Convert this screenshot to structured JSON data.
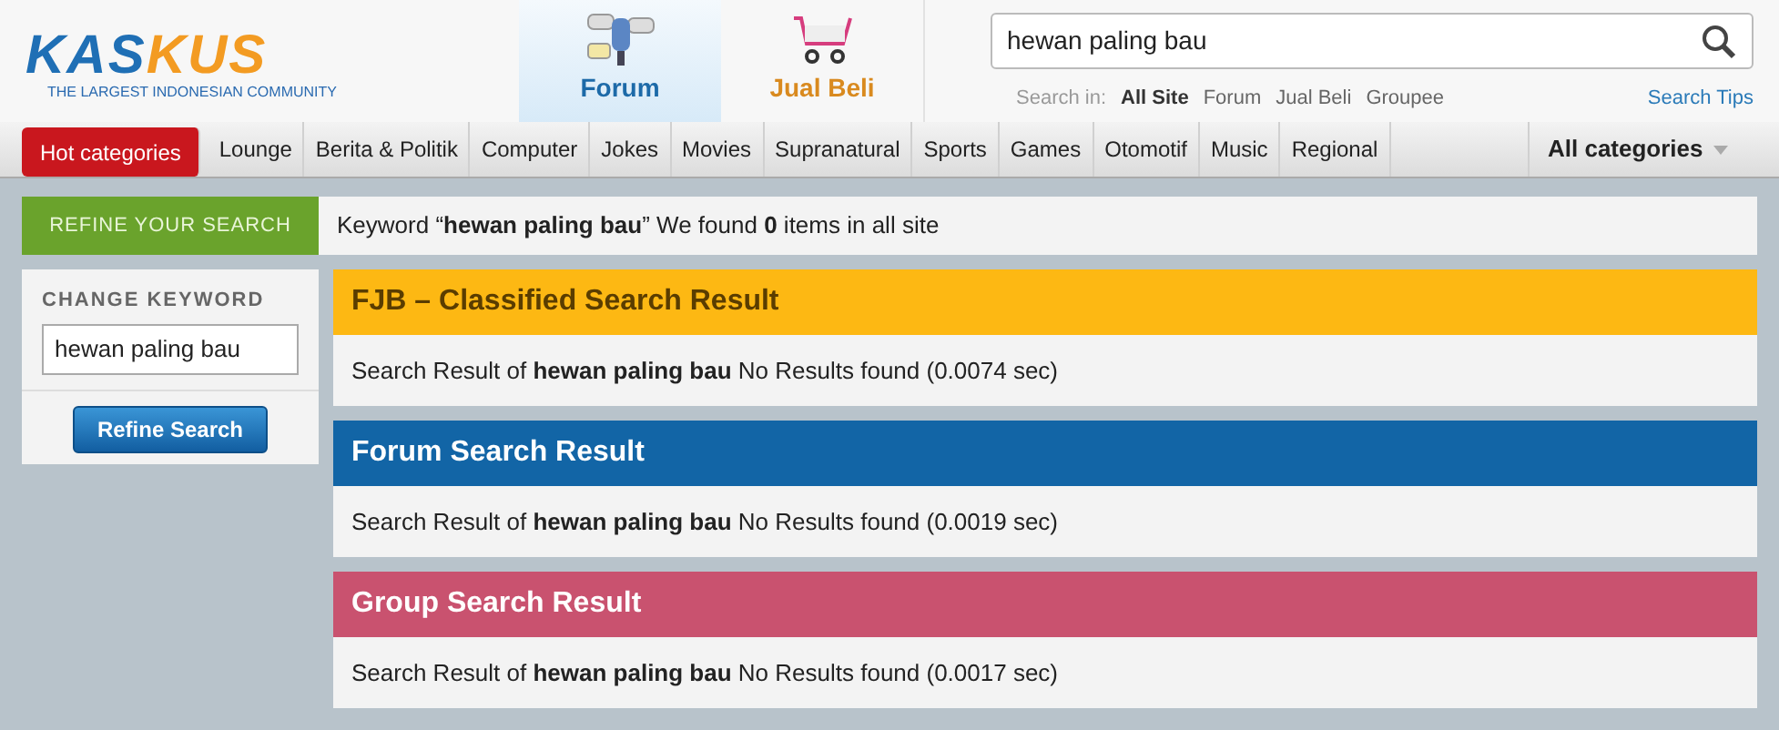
{
  "logo": {
    "part_one": "KAS",
    "part_two": "KUS",
    "tagline": "THE LARGEST INDONESIAN COMMUNITY"
  },
  "channel_tabs": [
    {
      "label": "Forum",
      "kind": "forum",
      "selected": true
    },
    {
      "label": "Jual Beli",
      "kind": "shop",
      "selected": false
    }
  ],
  "search": {
    "value": "hewan paling bau",
    "search_in_label": "Search in:",
    "scopes": [
      {
        "label": "All Site",
        "selected": true
      },
      {
        "label": "Forum",
        "selected": false
      },
      {
        "label": "Jual Beli",
        "selected": false
      },
      {
        "label": "Groupee",
        "selected": false
      }
    ],
    "tips": "Search Tips"
  },
  "categories": [
    {
      "label": "Hot categories",
      "selected": true
    },
    {
      "label": "Lounge",
      "selected": false
    },
    {
      "label": "Berita & Politik",
      "selected": false
    },
    {
      "label": "Computer",
      "selected": false
    },
    {
      "label": "Jokes",
      "selected": false
    },
    {
      "label": "Movies",
      "selected": false
    },
    {
      "label": "Supranatural",
      "selected": false
    },
    {
      "label": "Sports",
      "selected": false
    },
    {
      "label": "Games",
      "selected": false
    },
    {
      "label": "Otomotif",
      "selected": false
    },
    {
      "label": "Music",
      "selected": false
    },
    {
      "label": "Regional",
      "selected": false
    }
  ],
  "all_categories": "All categories",
  "refine": {
    "title": "REFINE YOUR SEARCH",
    "summary": "Keyword “**hewan paling bau**” We found **0** items in all site",
    "change_label": "CHANGE KEYWORD",
    "keyword": "hewan paling bau",
    "button": "Refine Search"
  },
  "results": [
    {
      "title": "FJB – Classified Search Result",
      "color": "#fdb813",
      "text": "Search Result of **hewan paling bau**  No Results found (0.0074 sec)"
    },
    {
      "title": "Forum Search Result",
      "color": "#1265a6",
      "text": "Search Result of **hewan paling bau** No Results found (0.0019 sec)"
    },
    {
      "title": "Group Search Result",
      "color": "#c9526f",
      "text": "Search Result of **hewan paling bau** No Results found (0.0017 sec)"
    }
  ]
}
